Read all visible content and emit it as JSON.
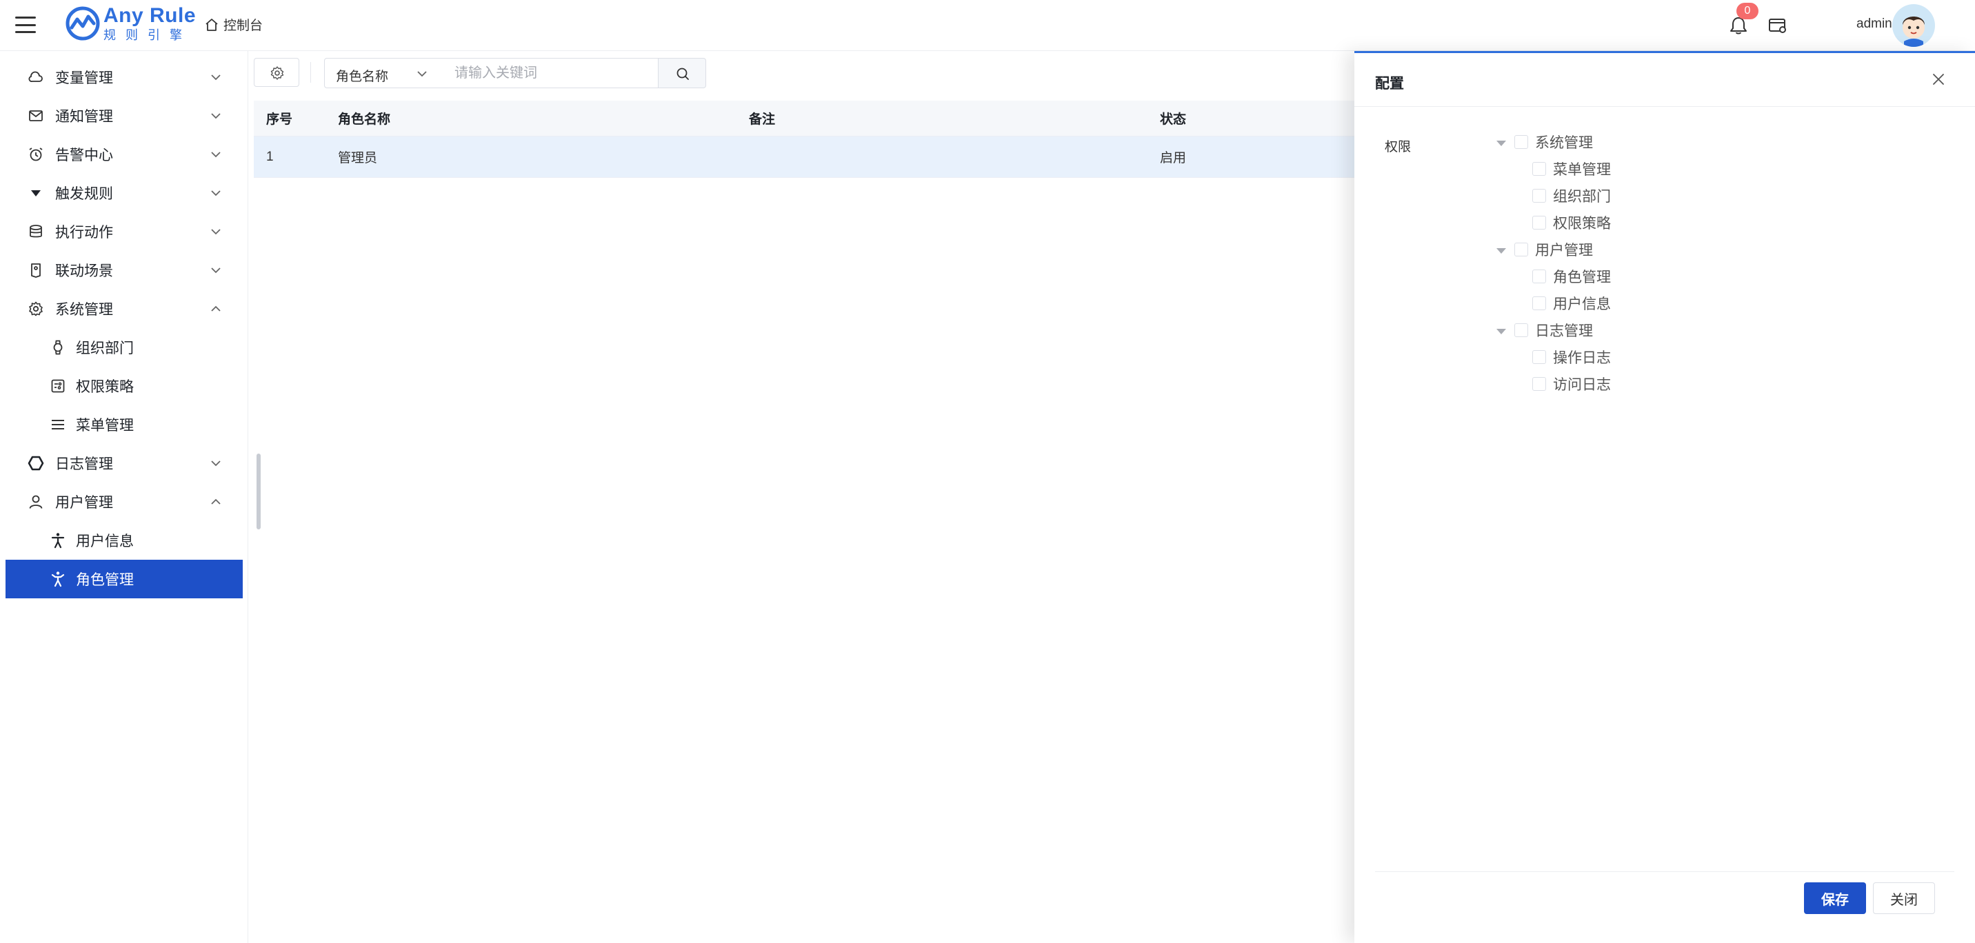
{
  "app": {
    "logo_title": "Any Rule",
    "logo_subtitle": "规则引擎",
    "home_label": "控制台",
    "username": "admin",
    "notification_count": "0"
  },
  "sidebar": {
    "items": [
      {
        "label": "变量管理",
        "icon": "cloud-icon",
        "expanded": false
      },
      {
        "label": "通知管理",
        "icon": "mail-icon",
        "expanded": false
      },
      {
        "label": "告警中心",
        "icon": "alarm-clock-icon",
        "expanded": false
      },
      {
        "label": "触发规则",
        "icon": "caret-down-icon",
        "expanded": false
      },
      {
        "label": "执行动作",
        "icon": "database-icon",
        "expanded": false
      },
      {
        "label": "联动场景",
        "icon": "tag-icon",
        "expanded": false
      },
      {
        "label": "系统管理",
        "icon": "gear-icon",
        "expanded": true,
        "children": [
          {
            "label": "组织部门",
            "icon": "watch-icon"
          },
          {
            "label": "权限策略",
            "icon": "policy-icon"
          },
          {
            "label": "菜单管理",
            "icon": "menu-icon"
          }
        ]
      },
      {
        "label": "日志管理",
        "icon": "hexagon-icon",
        "expanded": false
      },
      {
        "label": "用户管理",
        "icon": "user-icon",
        "expanded": true,
        "children": [
          {
            "label": "用户信息",
            "icon": "person-icon"
          },
          {
            "label": "角色管理",
            "icon": "person-role-icon",
            "active": true
          }
        ]
      }
    ]
  },
  "toolbar": {
    "select_value": "角色名称",
    "search_placeholder": "请输入关键词"
  },
  "table": {
    "columns": [
      "序号",
      "角色名称",
      "备注",
      "状态"
    ],
    "rows": [
      [
        "1",
        "管理员",
        "",
        "启用"
      ]
    ]
  },
  "drawer": {
    "title": "配置",
    "permission_label": "权限",
    "tree": [
      {
        "label": "系统管理",
        "children": [
          "菜单管理",
          "组织部门",
          "权限策略"
        ]
      },
      {
        "label": "用户管理",
        "children": [
          "角色管理",
          "用户信息"
        ]
      },
      {
        "label": "日志管理",
        "children": [
          "操作日志",
          "访问日志"
        ]
      }
    ],
    "save_label": "保存",
    "close_label": "关闭"
  },
  "colors": {
    "accent": "#1e50c8",
    "brand": "#2f6fdc",
    "badge": "#f56c6c",
    "selected_row": "#e8f1fc"
  }
}
